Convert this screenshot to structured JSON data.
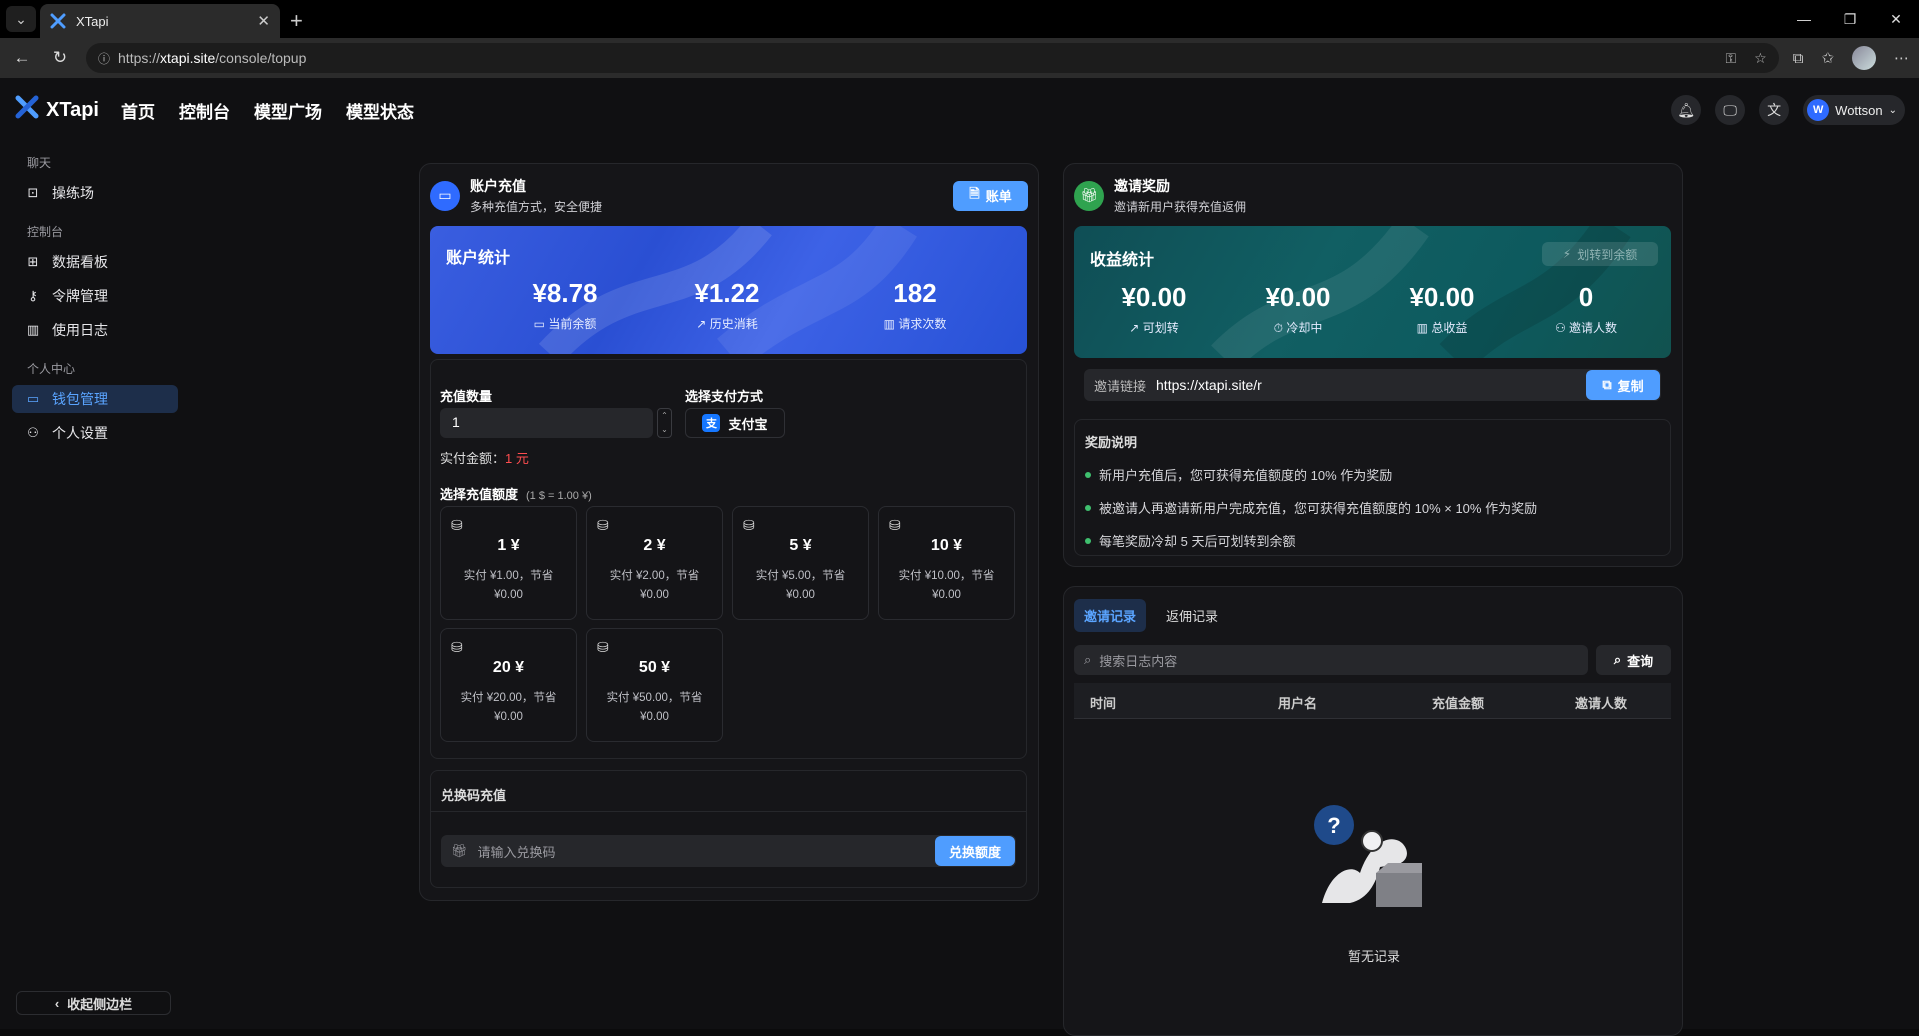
{
  "browser": {
    "tab_title": "XTapi",
    "url_prefix": "https://",
    "url_host": "xtapi.site",
    "url_path": "/console/topup"
  },
  "nav": {
    "brand": "XTapi",
    "links": [
      "首页",
      "控制台",
      "模型广场",
      "模型状态"
    ],
    "user": "Wottson",
    "user_initial": "W"
  },
  "sidebar": {
    "groups": [
      {
        "label": "聊天",
        "items": [
          {
            "label": "操练场",
            "icon": "terminal-icon"
          }
        ]
      },
      {
        "label": "控制台",
        "items": [
          {
            "label": "数据看板",
            "icon": "grid-icon"
          },
          {
            "label": "令牌管理",
            "icon": "key-icon"
          },
          {
            "label": "使用日志",
            "icon": "chart-icon"
          }
        ]
      },
      {
        "label": "个人中心",
        "items": [
          {
            "label": "钱包管理",
            "icon": "wallet-icon"
          },
          {
            "label": "个人设置",
            "icon": "user-icon"
          }
        ]
      }
    ],
    "active": "钱包管理",
    "collapse_label": "收起侧边栏"
  },
  "topup": {
    "title": "账户充值",
    "subtitle": "多种充值方式，安全便捷",
    "bill_button": "账单",
    "stats_title": "账户统计",
    "stats": [
      {
        "value": "¥8.78",
        "label": "当前余额"
      },
      {
        "value": "¥1.22",
        "label": "历史消耗"
      },
      {
        "value": "182",
        "label": "请求次数"
      }
    ],
    "quantity_label": "充值数量",
    "quantity_value": "1",
    "pay_label": "选择支付方式",
    "pay_method": "支付宝",
    "actual_label": "实付金额：",
    "actual_value": "1 元",
    "amount_label": "选择充值额度",
    "rate": "(1 $ = 1.00 ¥)",
    "amounts": [
      {
        "value": "1 ¥",
        "desc": "实付 ¥1.00，节省 ¥0.00"
      },
      {
        "value": "2 ¥",
        "desc": "实付 ¥2.00，节省 ¥0.00"
      },
      {
        "value": "5 ¥",
        "desc": "实付 ¥5.00，节省 ¥0.00"
      },
      {
        "value": "10 ¥",
        "desc": "实付 ¥10.00，节省 ¥0.00"
      },
      {
        "value": "20 ¥",
        "desc": "实付 ¥20.00，节省 ¥0.00"
      },
      {
        "value": "50 ¥",
        "desc": "实付 ¥50.00，节省 ¥0.00"
      }
    ],
    "redeem_title": "兑换码充值",
    "redeem_placeholder": "请输入兑换码",
    "redeem_button": "兑换额度"
  },
  "invite": {
    "title": "邀请奖励",
    "subtitle": "邀请新用户获得充值返佣",
    "stats_title": "收益统计",
    "transfer_button": "划转到余额",
    "stats": [
      {
        "value": "¥0.00",
        "label": "可划转"
      },
      {
        "value": "¥0.00",
        "label": "冷却中"
      },
      {
        "value": "¥0.00",
        "label": "总收益"
      },
      {
        "value": "0",
        "label": "邀请人数"
      }
    ],
    "link_label": "邀请链接",
    "link_value": "https://xtapi.site/r",
    "copy_button": "复制",
    "rules_title": "奖励说明",
    "rules": [
      "新用户充值后，您可获得充值额度的 10% 作为奖励",
      "被邀请人再邀请新用户完成充值，您可获得充值额度的 10% × 10% 作为奖励",
      "每笔奖励冷却 5 天后可划转到余额"
    ]
  },
  "records": {
    "tabs": [
      "邀请记录",
      "返佣记录"
    ],
    "search_placeholder": "搜索日志内容",
    "search_button": "查询",
    "columns": [
      "时间",
      "用户名",
      "充值金额",
      "邀请人数"
    ],
    "empty": "暂无记录"
  },
  "colors": {
    "accent": "#4f9dff",
    "active_bg": "#1d2e4a",
    "topup_banner": "#2d5bdc",
    "invite_banner": "#0f5a5e",
    "red": "#ff4d4f",
    "green": "#2fa34f"
  }
}
